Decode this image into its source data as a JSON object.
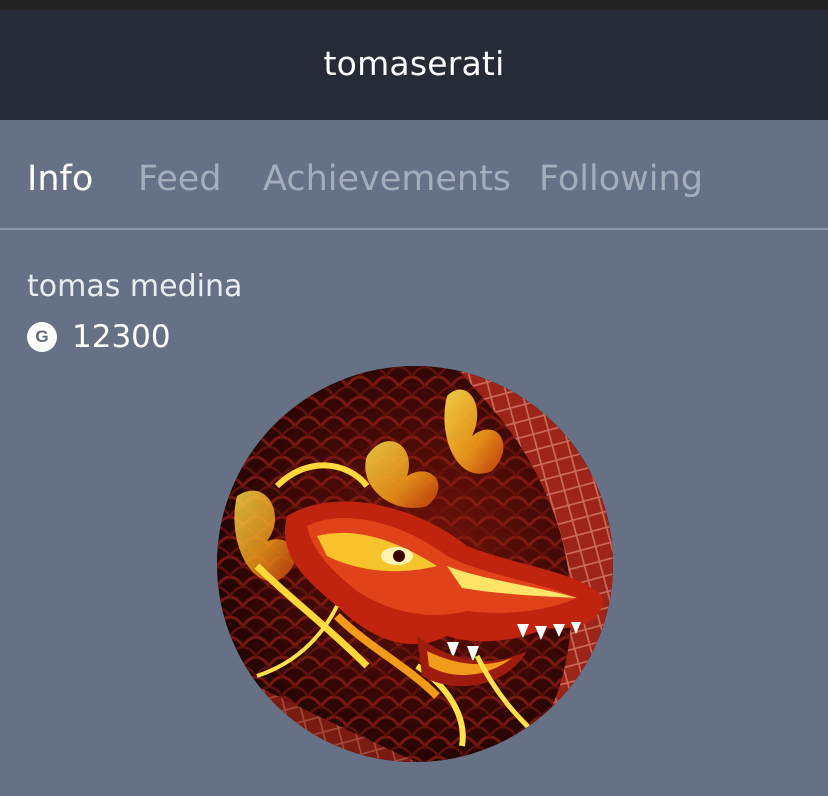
{
  "header": {
    "title": "tomaserati"
  },
  "tabs": [
    {
      "label": "Info",
      "active": true
    },
    {
      "label": "Feed",
      "active": false
    },
    {
      "label": "Achievements",
      "active": false
    },
    {
      "label": "Following",
      "active": false
    }
  ],
  "profile": {
    "full_name": "tomas medina",
    "coins_icon": "G",
    "coins": "12300",
    "avatar_icon": "dragon-avatar-image"
  },
  "colors": {
    "header_bg": "#252b37",
    "page_bg": "#667185",
    "active_tab": "#ffffff",
    "inactive_tab": "#a5adbb"
  }
}
